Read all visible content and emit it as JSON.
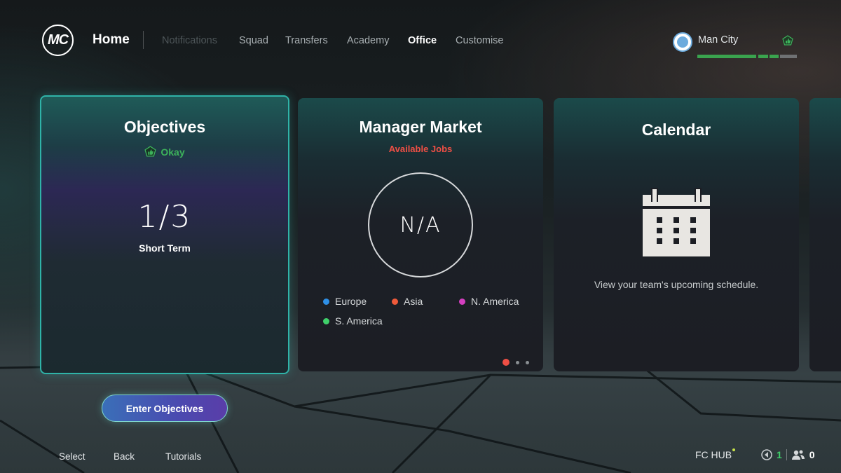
{
  "header": {
    "logo_text": "MC",
    "home": "Home",
    "nav": [
      {
        "label": "Notifications",
        "state": "disabled"
      },
      {
        "label": "Squad",
        "state": "normal"
      },
      {
        "label": "Transfers",
        "state": "normal"
      },
      {
        "label": "Academy",
        "state": "normal"
      },
      {
        "label": "Office",
        "state": "active"
      },
      {
        "label": "Customise",
        "state": "normal"
      }
    ],
    "club": {
      "name": "Man City",
      "status_icon": "thumbs-up-icon",
      "bar_segments": [
        "#3aa34e",
        "#3aa34e",
        "#3aa34e",
        "#707070"
      ]
    }
  },
  "cards": {
    "objectives": {
      "title": "Objectives",
      "status": "Okay",
      "status_icon": "thumbs-up-icon",
      "count": "1/3",
      "term": "Short Term"
    },
    "manager_market": {
      "title": "Manager Market",
      "subtitle": "Available Jobs",
      "center": "N/A",
      "legend": [
        {
          "label": "Europe",
          "color": "#2e8fe6"
        },
        {
          "label": "Asia",
          "color": "#ef5a3a"
        },
        {
          "label": "N. America",
          "color": "#d43fc0"
        },
        {
          "label": "S. America",
          "color": "#3fd06a"
        }
      ]
    },
    "calendar": {
      "title": "Calendar",
      "icon": "calendar-icon",
      "description": "View your team's upcoming schedule."
    }
  },
  "actions": {
    "enter": "Enter Objectives"
  },
  "footer": {
    "select": "Select",
    "back": "Back",
    "tutorials": "Tutorials",
    "hub": "FC HUB",
    "alerts_count": "1",
    "friends_count": "0"
  },
  "colors": {
    "accent_teal": "#2fb3a8",
    "jobs_red": "#ef4f45",
    "okay_green": "#3db25b"
  }
}
